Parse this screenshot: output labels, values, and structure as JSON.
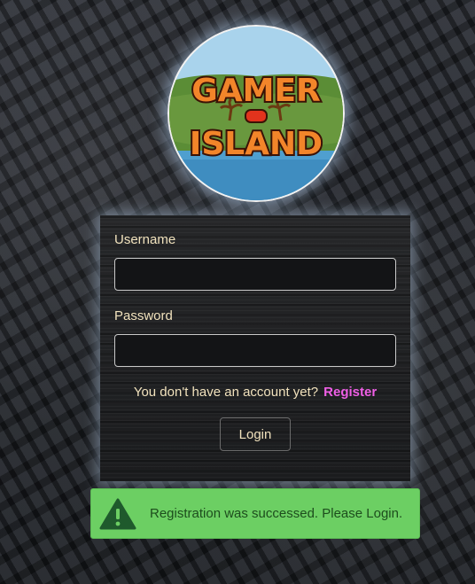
{
  "logo": {
    "line1": "GAMER",
    "line2": "ISLAND",
    "icon": "gamepad-island-logo"
  },
  "form": {
    "username_label": "Username",
    "username_value": "",
    "password_label": "Password",
    "password_value": "",
    "register_prompt": "You don't have an account yet?",
    "register_link": "Register",
    "login_button": "Login"
  },
  "alert": {
    "icon": "warning-icon",
    "message": "Registration was successed. Please Login."
  },
  "colors": {
    "label_text": "#f1e2bd",
    "register_link": "#ef5fe6",
    "alert_background": "#6ccf63",
    "alert_text": "#1d4d1d"
  }
}
